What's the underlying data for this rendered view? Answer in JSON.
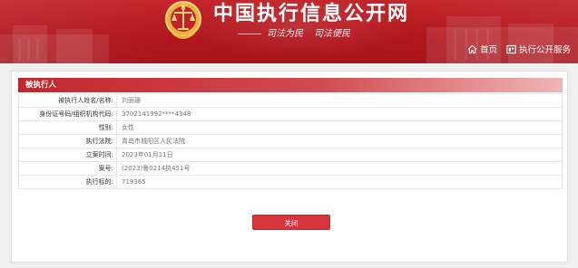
{
  "header": {
    "site_title": "中国执行信息公开网",
    "slogan_left": "司法为民",
    "slogan_right": "司法便民",
    "nav": [
      {
        "label": "首页",
        "icon": "home-icon"
      },
      {
        "label": "执行公开服务",
        "icon": "service-icon"
      }
    ]
  },
  "panel": {
    "title": "被执行人",
    "rows": [
      {
        "label": "被执行人姓名/名称:",
        "value": "刘丽珊"
      },
      {
        "label": "身份证号码/组织机构代码:",
        "value": "37021419​92****4348"
      },
      {
        "label": "性别:",
        "value": "女性"
      },
      {
        "label": "执行法院:",
        "value": "青岛市城阳区人民法院"
      },
      {
        "label": "立案时间:",
        "value": "2023年01月11日"
      },
      {
        "label": "案号:",
        "value": "(2023)鲁0214执451号"
      },
      {
        "label": "执行标的:",
        "value": "719365"
      }
    ],
    "close_label": "关闭"
  },
  "colors": {
    "brand_red": "#b2171d",
    "button_red": "#d6363b",
    "panel_head_red": "#c1272d"
  }
}
